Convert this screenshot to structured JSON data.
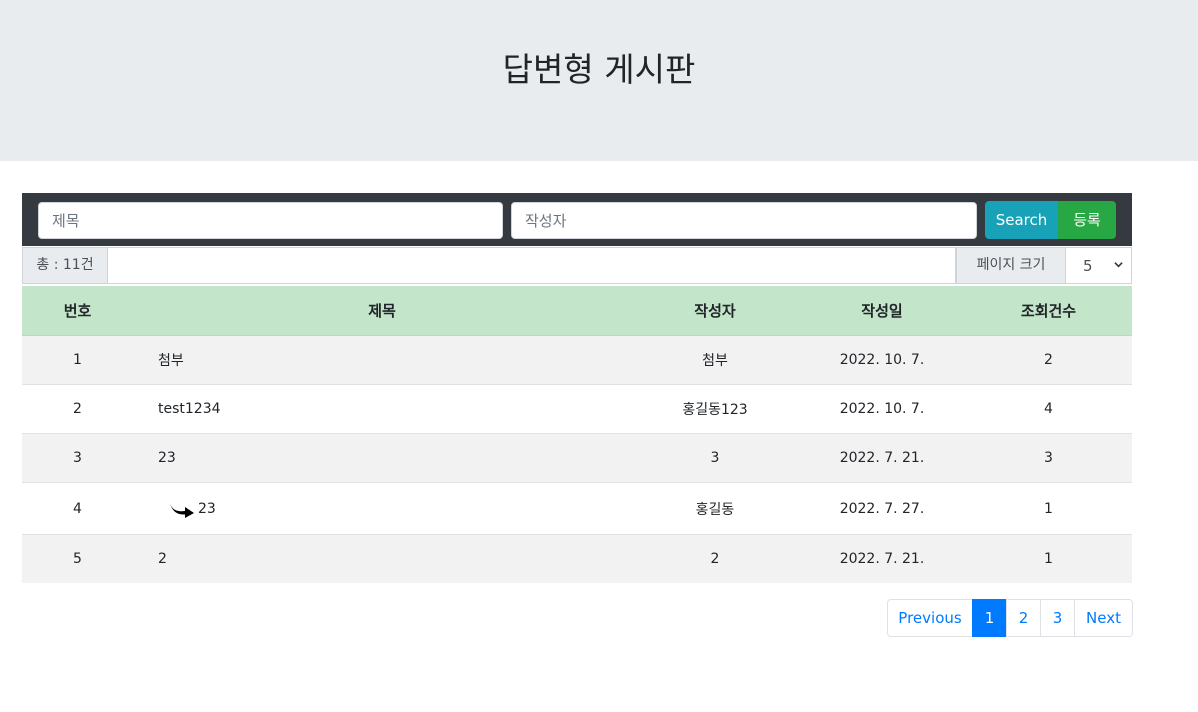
{
  "header": {
    "title": "답변형 게시판"
  },
  "search": {
    "title_placeholder": "제목",
    "writer_placeholder": "작성자",
    "search_label": "Search",
    "register_label": "등록"
  },
  "info": {
    "total": "총 : 11건",
    "page_size_label": "페이지 크기",
    "page_size_value": "5"
  },
  "table": {
    "headers": [
      "번호",
      "제목",
      "작성자",
      "작성일",
      "조회건수"
    ],
    "rows": [
      {
        "no": "1",
        "title": "첨부",
        "writer": "첨부",
        "date": "2022. 10. 7.",
        "views": "2",
        "reply": false
      },
      {
        "no": "2",
        "title": "test1234",
        "writer": "홍길동123",
        "date": "2022. 10. 7.",
        "views": "4",
        "reply": false
      },
      {
        "no": "3",
        "title": "23",
        "writer": "3",
        "date": "2022. 7. 21.",
        "views": "3",
        "reply": false
      },
      {
        "no": "4",
        "title": "23",
        "writer": "홍길동",
        "date": "2022. 7. 27.",
        "views": "1",
        "reply": true
      },
      {
        "no": "5",
        "title": "2",
        "writer": "2",
        "date": "2022. 7. 21.",
        "views": "1",
        "reply": false
      }
    ]
  },
  "pagination": {
    "previous": "Previous",
    "pages": [
      "1",
      "2",
      "3"
    ],
    "active": "1",
    "next": "Next"
  },
  "colors": {
    "header_bg": "#e9ecef",
    "search_bar_bg": "#343a40",
    "search_button": "#17a2b8",
    "register_button": "#28a745",
    "table_header_bg": "#c3e6cb",
    "active_page": "#007bff"
  },
  "icons": {
    "reply": "reply-arrow-icon",
    "select": "chevron-down-icon"
  }
}
